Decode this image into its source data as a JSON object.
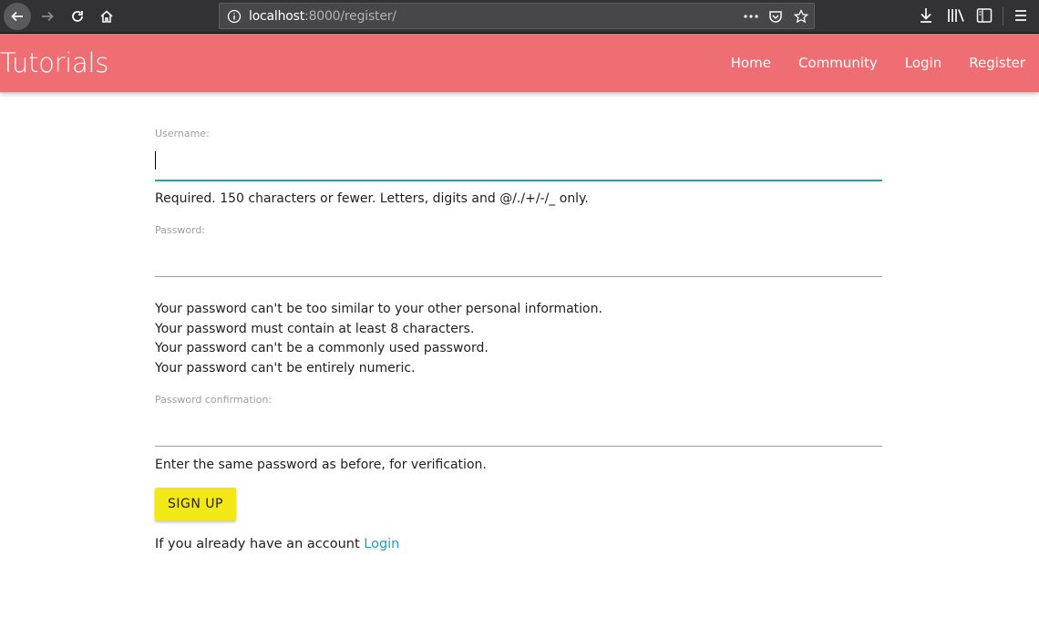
{
  "browser": {
    "url_host": "localhost",
    "url_rest": ":8000/register/"
  },
  "navbar": {
    "brand": "Tutorials",
    "links": [
      "Home",
      "Community",
      "Login",
      "Register"
    ],
    "bg_color": "#ef6e73"
  },
  "form": {
    "username": {
      "label": "Username:",
      "value": "",
      "help": "Required. 150 characters or fewer. Letters, digits and @/./+/-/_ only."
    },
    "password": {
      "label": "Password:",
      "value": "",
      "help": [
        "Your password can't be too similar to your other personal information.",
        "Your password must contain at least 8 characters.",
        "Your password can't be a commonly used password.",
        "Your password can't be entirely numeric."
      ]
    },
    "password_confirmation": {
      "label": "Password confirmation:",
      "value": "",
      "help": "Enter the same password as before, for verification."
    },
    "submit_label": "SIGN UP",
    "login_prompt": "If you already have an account",
    "login_link": "Login"
  },
  "colors": {
    "accent_focus": "#26a69a",
    "button": "#f2e816",
    "link": "#1a9cc4"
  }
}
